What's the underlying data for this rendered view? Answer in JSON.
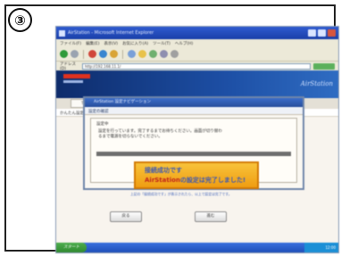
{
  "step": {
    "number": "③"
  },
  "window": {
    "title": "AirStation - Microsoft Internet Explorer",
    "menu": [
      "ファイル(F)",
      "編集(E)",
      "表示(V)",
      "お気に入り(A)",
      "ツール(T)",
      "ヘルプ(H)"
    ],
    "address_label": "アドレス(D)",
    "address_value": "http://192.168.11.1/"
  },
  "site": {
    "brand": "AirStation"
  },
  "nav": {
    "tab_label": "TOP"
  },
  "breadcrumb": "かんたん設定ナビゲーション",
  "dialog": {
    "title": "AirStation 設定ナビゲーション",
    "subtitle": "設定の確認",
    "box_label": "設定中",
    "message": "設定を行っています。完了するまでお待ちください。画面が切り替わるまで電源を切らないでください。",
    "banner_line1": "接続成功です",
    "banner_line2_hl": "AirStation",
    "banner_line2_rest": "の設定は完了しました!",
    "caption": "上記の「接続成功です」が表示されたら、以上で設定は完了です。"
  },
  "buttons": {
    "back": "戻る",
    "next": "進む"
  },
  "taskbar": {
    "start": "スタート",
    "tray_time": "12:00"
  },
  "colors": {
    "accent": "#1d4fa5",
    "banner": "#f8c33a",
    "highlight": "#c0251b"
  }
}
